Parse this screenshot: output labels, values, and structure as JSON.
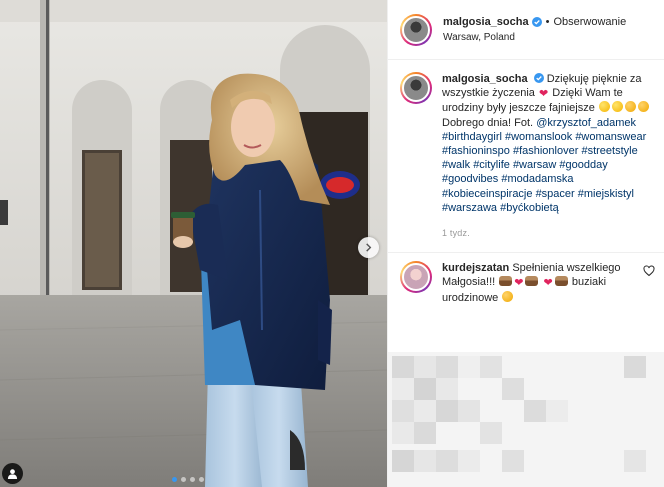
{
  "post": {
    "author": {
      "username": "malgosia_socha",
      "verified": true,
      "follow_label": "Obserwowanie",
      "location": "Warsaw, Poland",
      "separator": "•"
    },
    "caption": {
      "username": "malgosia_socha",
      "text_1": "Dziękuję pięknie za wszystkie życzenia",
      "text_2": "Dzięki Wam te urodziny były jeszcze fajniejsze",
      "text_3": "Dobrego dnia! Fot.",
      "mention": "@krzysztof_adamek",
      "hashtags": [
        "#birthdaygirl",
        "#womanslook",
        "#womanswear",
        "#fashioninspo",
        "#fashionlover",
        "#streetstyle",
        "#walk",
        "#citylife",
        "#warsaw",
        "#goodday",
        "#goodvibes",
        "#modadamska",
        "#kobieceinspiracje",
        "#spacer",
        "#miejskistyl",
        "#warszawa",
        "#byćkobietą"
      ],
      "time": "1 tydz."
    },
    "comment": {
      "username": "kurdejszatan",
      "text_1": "Spełnienia wszelkiego Małgosia!!!",
      "text_2": "buziaki urodzinowe"
    },
    "carousel": {
      "slides": 4,
      "active_index": 0
    }
  },
  "icons": {
    "verified": "verified-badge-icon",
    "next": "chevron-right-icon",
    "tag": "user-tag-icon",
    "like": "heart-outline-icon"
  },
  "colors": {
    "link": "#003569",
    "verified": "#3897f0",
    "heart": "#e0245e",
    "border": "#efefef"
  }
}
